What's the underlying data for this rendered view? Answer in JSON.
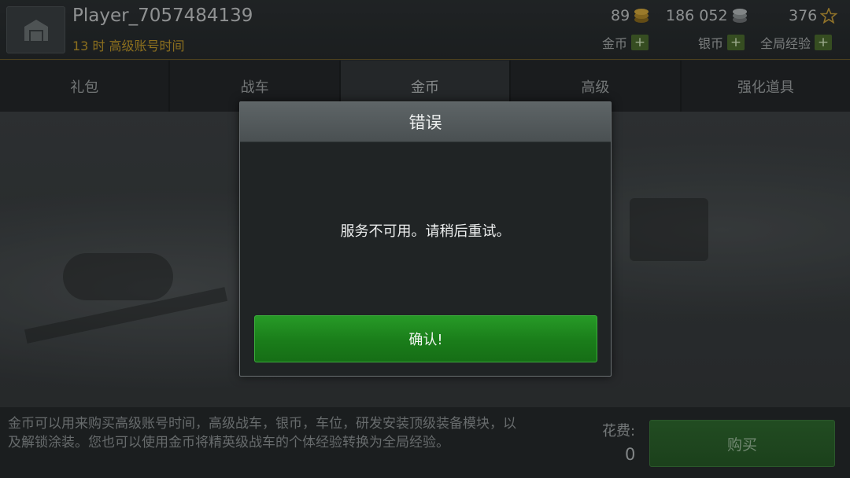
{
  "header": {
    "player_name": "Player_7057484139",
    "premium_time": "13 时 高级账号时间",
    "resources": {
      "gold_value": "89",
      "gold_label": "金币",
      "silver_value": "186 052",
      "silver_label": "银币",
      "xp_value": "376",
      "xp_label": "全局经验",
      "plus": "+"
    }
  },
  "tabs": [
    {
      "label": "礼包"
    },
    {
      "label": "战车"
    },
    {
      "label": "金币"
    },
    {
      "label": "高级"
    },
    {
      "label": "强化道具"
    }
  ],
  "active_tab_index": 2,
  "footer": {
    "description": "金币可以用来购买高级账号时间，高级战车，银币，车位，研发安装顶级装备模块，以及解锁涂装。您也可以使用金币将精英级战车的个体经验转换为全局经验。",
    "cost_label": "花费:",
    "cost_value": "0",
    "buy_label": "购买"
  },
  "dialog": {
    "title": "错误",
    "message": "服务不可用。请稍后重试。",
    "confirm_label": "确认!"
  },
  "colors": {
    "gold_accent": "#c29a2a",
    "confirm_green": "#1a7d1a",
    "plus_green": "#4b6b2e"
  }
}
